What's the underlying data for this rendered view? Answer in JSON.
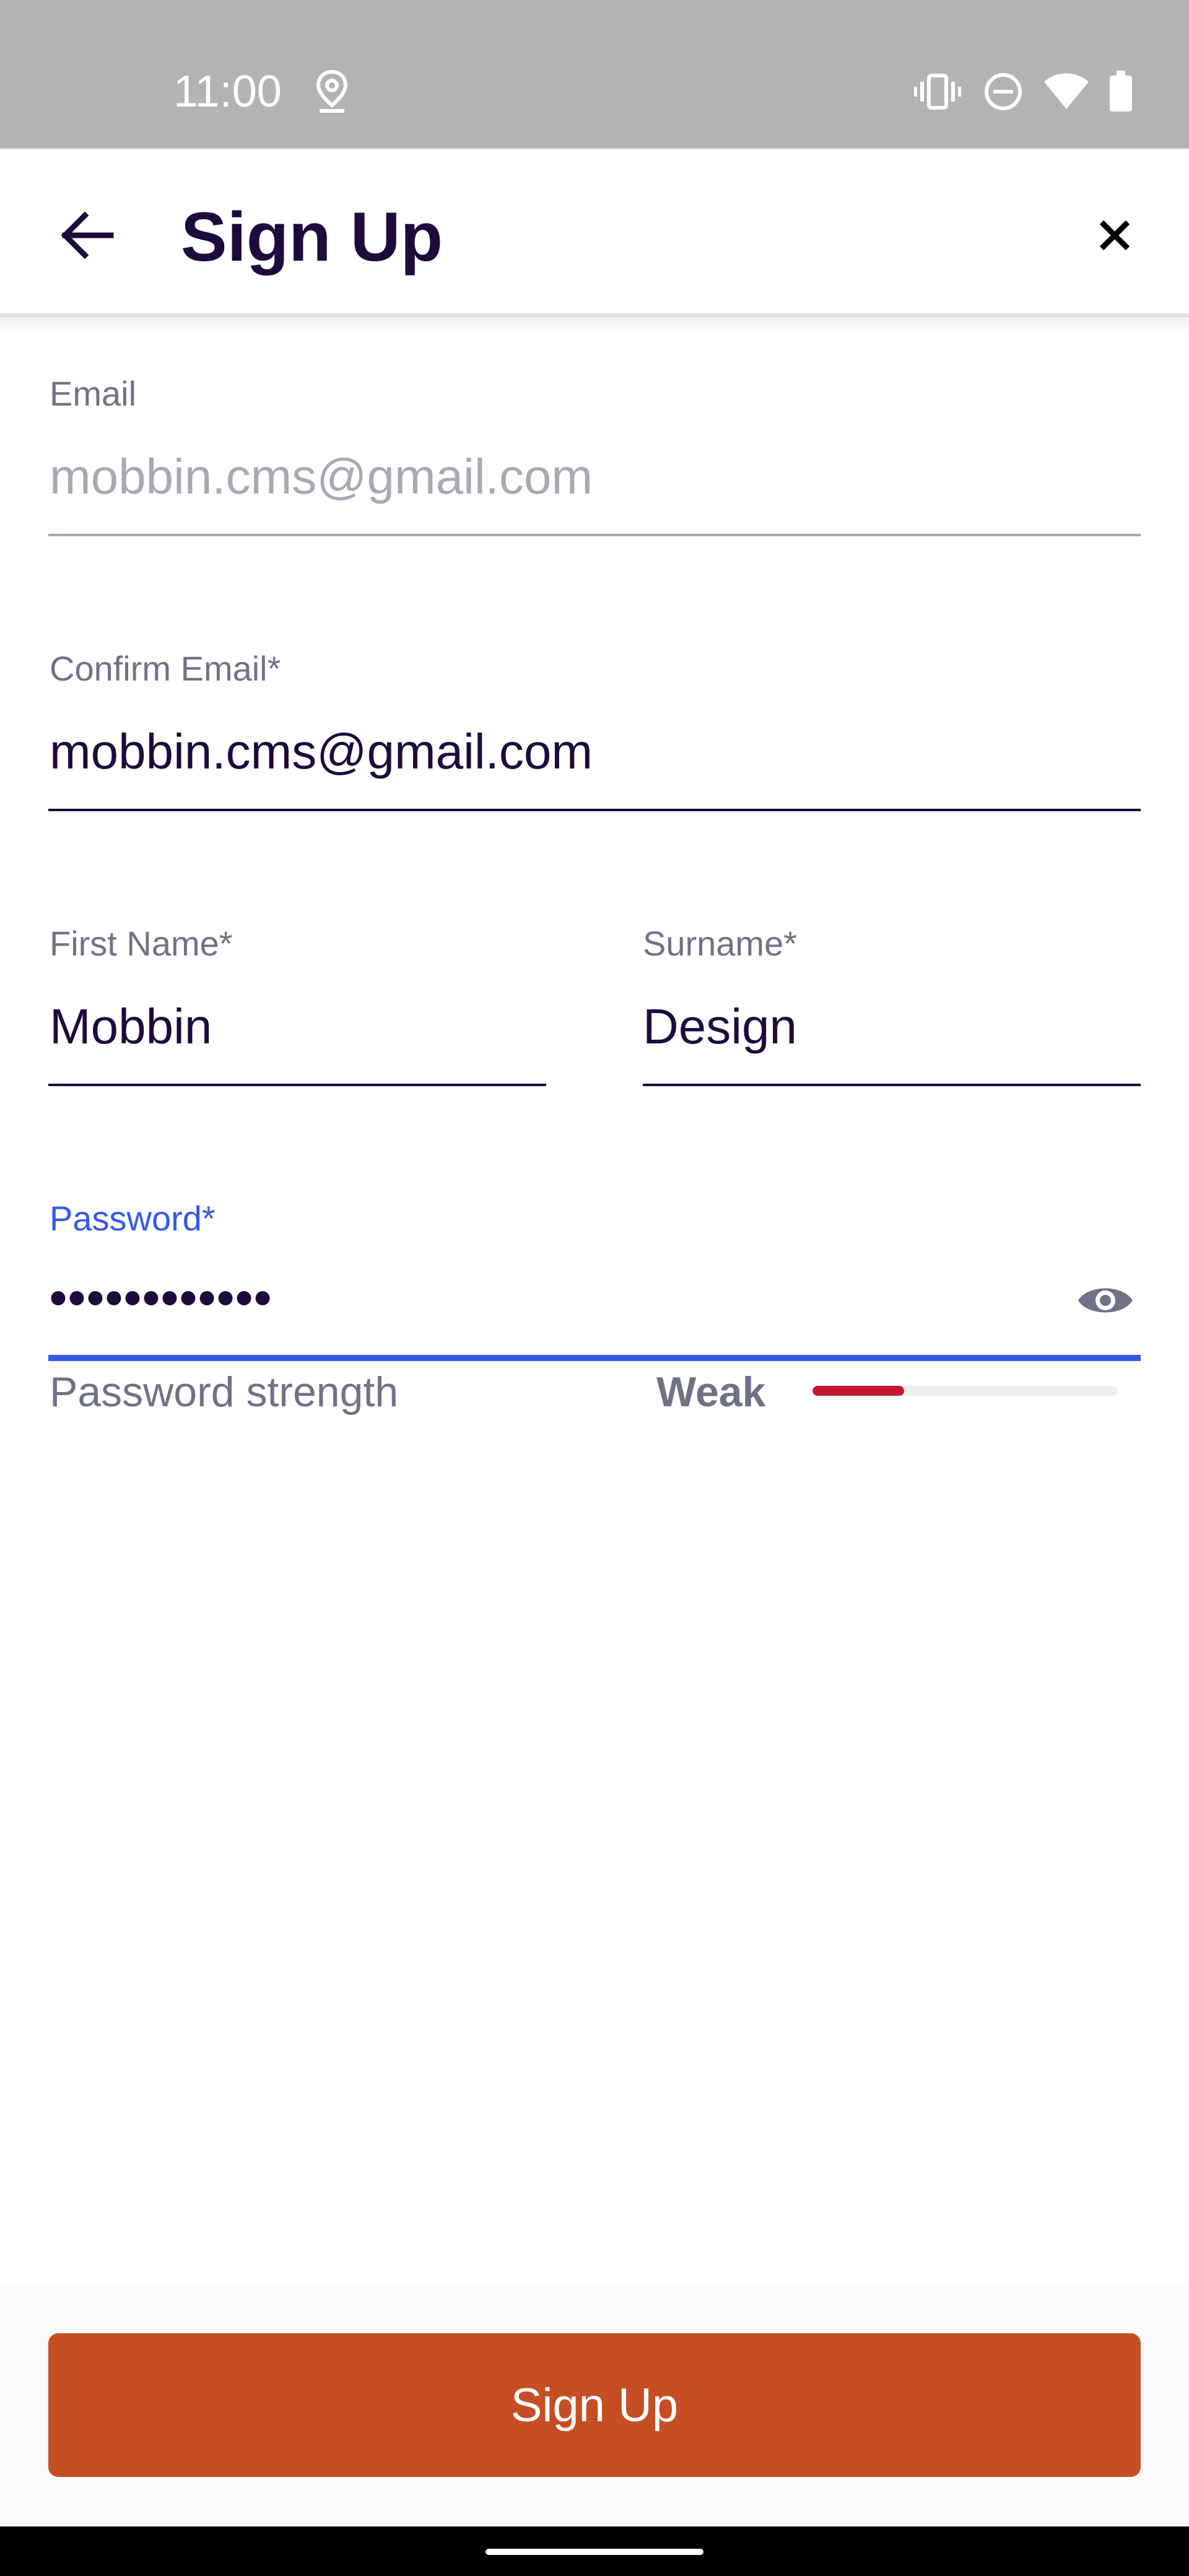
{
  "status_bar": {
    "time": "11:00",
    "icons": [
      "location-icon",
      "vibrate-icon",
      "do-not-disturb-icon",
      "wifi-icon",
      "battery-icon"
    ]
  },
  "header": {
    "title": "Sign Up",
    "back_icon": "arrow-left-icon",
    "close_icon": "close-icon"
  },
  "form": {
    "email": {
      "label": "Email",
      "value": "mobbin.cms@gmail.com"
    },
    "confirm_email": {
      "label": "Confirm Email*",
      "value": "mobbin.cms@gmail.com"
    },
    "first_name": {
      "label": "First Name*",
      "value": "Mobbin"
    },
    "surname": {
      "label": "Surname*",
      "value": "Design"
    },
    "password": {
      "label": "Password*",
      "value": "••••••••••••",
      "visibility_icon": "eye-icon",
      "strength_label": "Password strength",
      "strength_value": "Weak",
      "strength_fraction": 0.3
    }
  },
  "footer": {
    "signup_label": "Sign Up"
  },
  "colors": {
    "text_primary": "#1e0a3c",
    "text_secondary": "#6f7287",
    "focus_blue": "#3659e3",
    "strength_weak": "#c5162e",
    "button_orange": "#c64e24",
    "status_bar_gray": "#b3b3b3"
  }
}
